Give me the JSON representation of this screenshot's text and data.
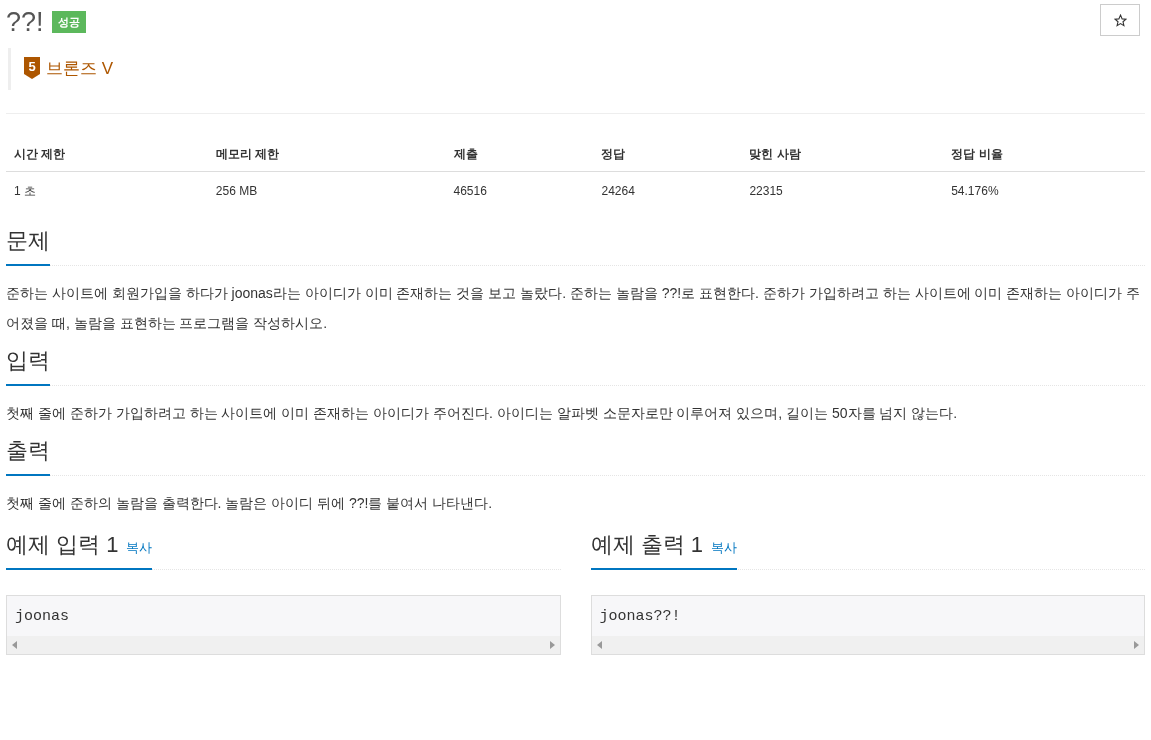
{
  "title": "??!",
  "result_badge": "성공",
  "tier": {
    "number": "5",
    "label": "브론즈 V"
  },
  "stats": {
    "columns": [
      "시간 제한",
      "메모리 제한",
      "제출",
      "정답",
      "맞힌 사람",
      "정답 비율"
    ],
    "rows": [
      [
        "1 초",
        "256 MB",
        "46516",
        "24264",
        "22315",
        "54.176%"
      ]
    ]
  },
  "sections": [
    {
      "heading": "문제",
      "text": "준하는 사이트에 회원가입을 하다가 joonas라는 아이디가 이미 존재하는 것을 보고 놀랐다. 준하는 놀람을 ??!로 표현한다. 준하가 가입하려고 하는 사이트에 이미 존재하는 아이디가 주어졌을 때, 놀람을 표현하는 프로그램을 작성하시오."
    },
    {
      "heading": "입력",
      "text": "첫째 줄에 준하가 가입하려고 하는 사이트에 이미 존재하는 아이디가 주어진다. 아이디는 알파벳 소문자로만 이루어져 있으며, 길이는 50자를 넘지 않는다."
    },
    {
      "heading": "출력",
      "text": "첫째 줄에 준하의 놀람을 출력한다. 놀람은 아이디 뒤에 ??!를 붙여서 나타낸다."
    }
  ],
  "samples": [
    {
      "heading": "예제 입력 1",
      "copy": "복사",
      "content": "joonas"
    },
    {
      "heading": "예제 출력 1",
      "copy": "복사",
      "content": "joonas??!"
    }
  ]
}
